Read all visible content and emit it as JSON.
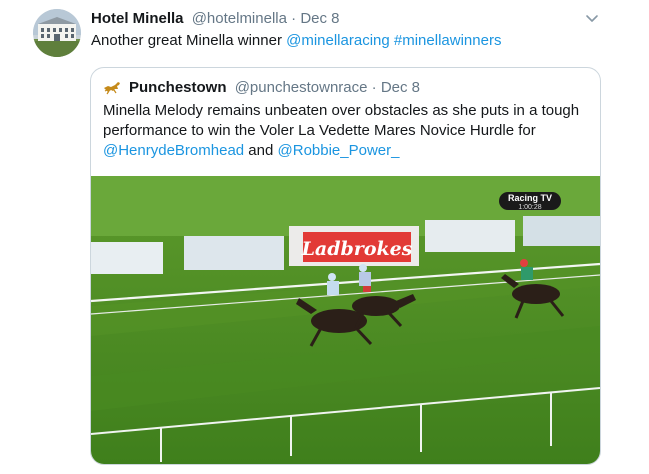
{
  "tweet": {
    "name": "Hotel Minella",
    "handle": "@hotelminella",
    "separator": "·",
    "date": "Dec 8",
    "text_plain": "Another great Minella winner",
    "mention": "@minellaracing",
    "hashtag": "#minellawinners"
  },
  "quoted": {
    "name": "Punchestown",
    "handle": "@punchestownrace",
    "separator": "·",
    "date": "Dec 8",
    "text_1": "Minella Melody remains unbeaten over obstacles as she puts in a tough performance to win the Voler La Vedette Mares Novice Hurdle for ",
    "mention_1": "@HenrydeBromhead",
    "text_2": " and ",
    "mention_2": "@Robbie_Power_"
  },
  "video": {
    "channel_logo": "Racing TV",
    "clock": "1:00:28",
    "sponsor_board": "Ladbrokes"
  },
  "colors": {
    "link": "#1b95e0",
    "muted": "#657786",
    "border": "#ccd6dd",
    "grass": "#4f8f1f"
  },
  "icons": [
    "avatar-image",
    "chevron-down-icon",
    "horse-logo-icon"
  ]
}
